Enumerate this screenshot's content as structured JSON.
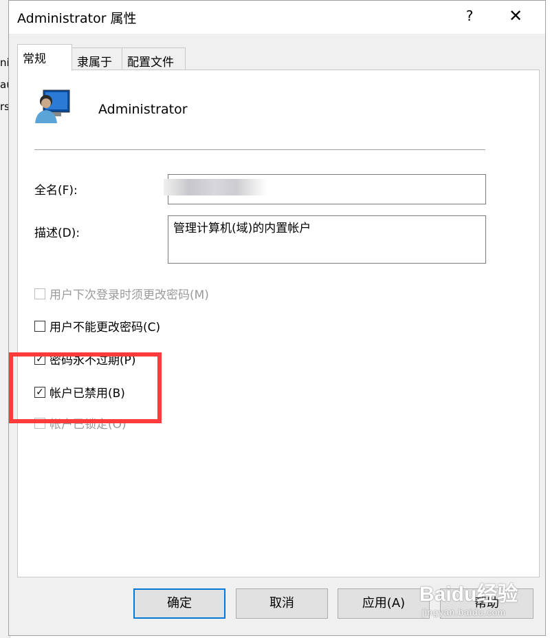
{
  "background": {
    "fragments": [
      "ni",
      "au",
      "rs"
    ]
  },
  "dialog": {
    "title": "Administrator 属性",
    "help_label": "?",
    "close_label": "✕"
  },
  "tabs": [
    {
      "label": "常规",
      "active": true
    },
    {
      "label": "隶属于",
      "active": false
    },
    {
      "label": "配置文件",
      "active": false
    }
  ],
  "user": {
    "name": "Administrator",
    "icon": "user-monitor-icon"
  },
  "fields": {
    "fullname_label": "全名(F):",
    "fullname_value": "",
    "description_label": "描述(D):",
    "description_value": "管理计算机(域)的内置帐户"
  },
  "checkboxes": [
    {
      "label": "用户下次登录时须更改密码(M)",
      "checked": false,
      "disabled": true
    },
    {
      "label": "用户不能更改密码(C)",
      "checked": false,
      "disabled": false
    },
    {
      "label": "密码永不过期(P)",
      "checked": true,
      "disabled": false
    },
    {
      "label": "帐户已禁用(B)",
      "checked": true,
      "disabled": false
    },
    {
      "label": "帐户已锁定(O)",
      "checked": false,
      "disabled": true
    }
  ],
  "buttons": {
    "ok": "确定",
    "cancel": "取消",
    "apply": "应用(A)",
    "help": "帮助"
  },
  "watermark": {
    "logo": "Baidu经验",
    "url": "jingyan.baidu.com"
  },
  "colors": {
    "highlight": "#ff3b3b",
    "accent": "#0078d7",
    "dialog_bg": "#f0f0f0"
  }
}
